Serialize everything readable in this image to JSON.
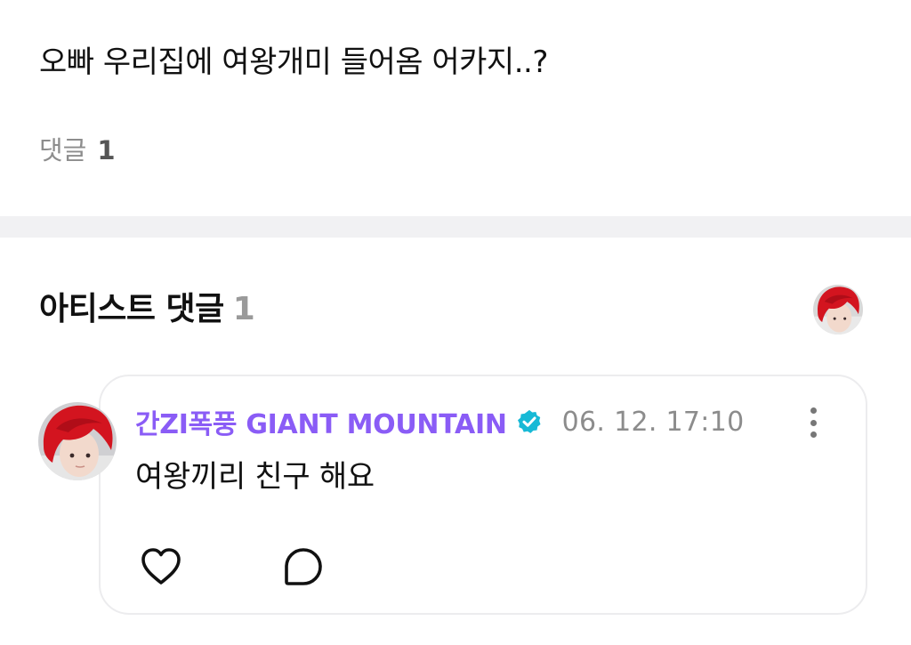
{
  "post": {
    "text": "오빠 우리집에 여왕개미 들어옴 어카지..?",
    "comment_label": "댓글",
    "comment_count": "1"
  },
  "artist_comments": {
    "title": "아티스트 댓글",
    "count": "1",
    "comments": [
      {
        "author": "간ZI폭풍 GIANT MOUNTAIN",
        "timestamp": "06. 12. 17:10",
        "text": "여왕끼리 친구 해요"
      }
    ]
  },
  "colors": {
    "author": "#8a5cf6",
    "verified_badge": "#17b9d6",
    "muted_text": "#8c8c8c",
    "divider": "#f1f1f3"
  },
  "icons": {
    "verified": "verified-badge-icon",
    "more": "more-vertical-icon",
    "like": "heart-icon",
    "reply": "comment-bubble-icon"
  }
}
